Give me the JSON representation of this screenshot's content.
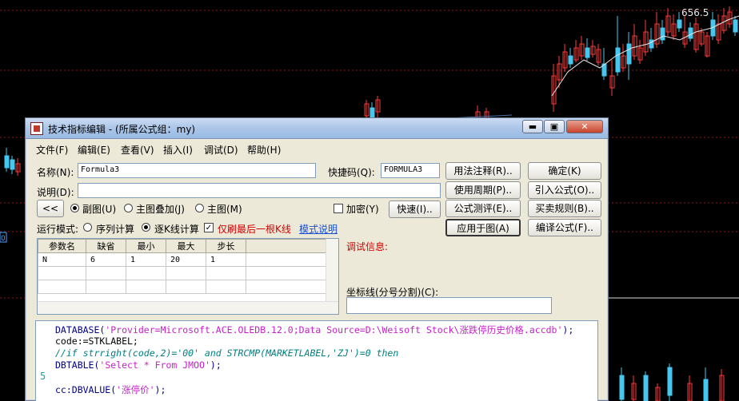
{
  "chart": {
    "price_label": "656.5",
    "axis_tag": "0",
    "colors": {
      "up": "#ff3b3b",
      "down": "#45c8ef",
      "grid": "#8b1a1a",
      "bg": "#000000",
      "ma": "#e6e6e6"
    }
  },
  "window": {
    "title": "技术指标编辑 - (所属公式组：my)",
    "icon": "formula-editor-icon",
    "minimize_label": "▬",
    "maximize_label": "▣",
    "close_label": "✕"
  },
  "menu": [
    "文件(F)",
    "编辑(E)",
    "查看(V)",
    "插入(I)",
    "调试(D)",
    "帮助(H)"
  ],
  "form": {
    "name_label": "名称(N):",
    "name_value": "Formula3",
    "hotkey_label": "快捷码(Q):",
    "hotkey_value": "FORMULA3",
    "desc_label": "说明(D):",
    "desc_value": "",
    "collapse_label": "<<",
    "radio_sub": "副图(U)",
    "radio_overlay": "主图叠加(J)",
    "radio_main": "主图(M)",
    "encrypt_label": "加密(Y)",
    "quick_label": "快速(I)..",
    "run_mode_label": "运行模式:",
    "radio_seq": "序列计算",
    "radio_kline": "逐K线计算",
    "refresh_last_label": "仅刷最后一根K线",
    "mode_help_label": "模式说明"
  },
  "buttons": {
    "syntax": "用法注释(R)..",
    "ok": "确定(K)",
    "period": "使用周期(P)..",
    "import": "引入公式(O)..",
    "test": "公式测评(E)..",
    "trade_rule": "买卖规则(B)..",
    "apply": "应用于图(A)",
    "compile": "编译公式(F).."
  },
  "params": {
    "headers": [
      "参数名",
      "缺省",
      "最小",
      "最大",
      "步长"
    ],
    "rows": [
      [
        "N",
        "6",
        "1",
        "20",
        "1"
      ]
    ]
  },
  "debug": {
    "label": "调试信息:",
    "coord_label": "坐标线(分号分割)(C):",
    "coord_value": ""
  },
  "code": {
    "line1_fn": "DATABASE",
    "line1_str": "'Provider=Microsoft.ACE.OLEDB.12.0;Data Source=D:\\Weisoft Stock\\涨跌停历史价格.accdb'",
    "line2": "code:=STKLABEL;",
    "line3": "//if strright(code,2)='00' and STRCMP(MARKETLABEL,'ZJ')=0 then",
    "line4_fn": "DBTABLE",
    "line4_str": "'Select * From JMOO'",
    "line5_num": "5",
    "line6_fn": "cc:DBVALUE",
    "line6_str": "'涨停价'",
    "close_paren": ");",
    "open_paren": "(",
    "close_paren_only": ")"
  }
}
